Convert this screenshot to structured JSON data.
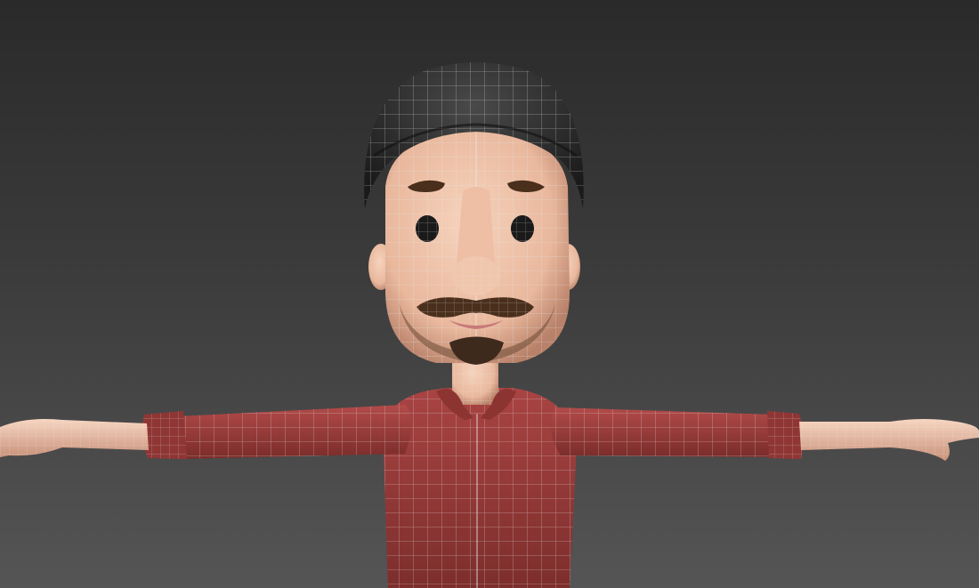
{
  "scene": {
    "description_kind": "3d-viewport-render",
    "colors": {
      "background_top": "#2a2a2a",
      "background_bottom": "#555555",
      "skin": "#f3c7ad",
      "skin_shadow": "#c99279",
      "beanie": "#3a3a3a",
      "beanie_dark": "#1c1c1c",
      "shirt": "#9c3d3c",
      "shirt_dark": "#6f2624",
      "hair": "#4a2f1c",
      "wireframe": "#d9d9d9"
    }
  }
}
